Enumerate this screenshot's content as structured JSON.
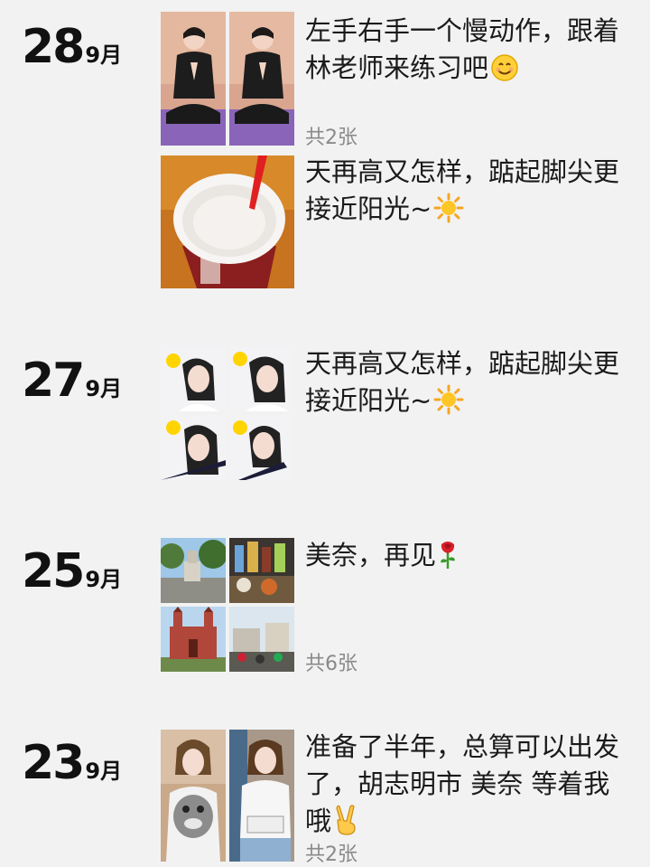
{
  "posts": [
    {
      "day": "28",
      "month": "9月",
      "entries": [
        {
          "text": "左手右手一个慢动作，跟着林老师来练习吧",
          "emoji": "smile-icon",
          "count": "共2张"
        },
        {
          "text": "天再高又怎样，踮起脚尖更接近阳光~",
          "emoji": "sun-icon",
          "count": ""
        }
      ]
    },
    {
      "day": "27",
      "month": "9月",
      "text": "天再高又怎样，踮起脚尖更接近阳光~",
      "emoji": "sun-icon",
      "count": ""
    },
    {
      "day": "25",
      "month": "9月",
      "text": "美奈，再见",
      "emoji": "rose-icon",
      "count": "共6张"
    },
    {
      "day": "23",
      "month": "9月",
      "text": "准备了半年，总算可以出发了，胡志明市 美奈 等着我哦",
      "emoji": "victory-hand-icon",
      "count": "共2张"
    }
  ],
  "colors": {
    "background": "#f2f2f2",
    "text": "#1a1a1a",
    "count": "#8a8a8a"
  }
}
